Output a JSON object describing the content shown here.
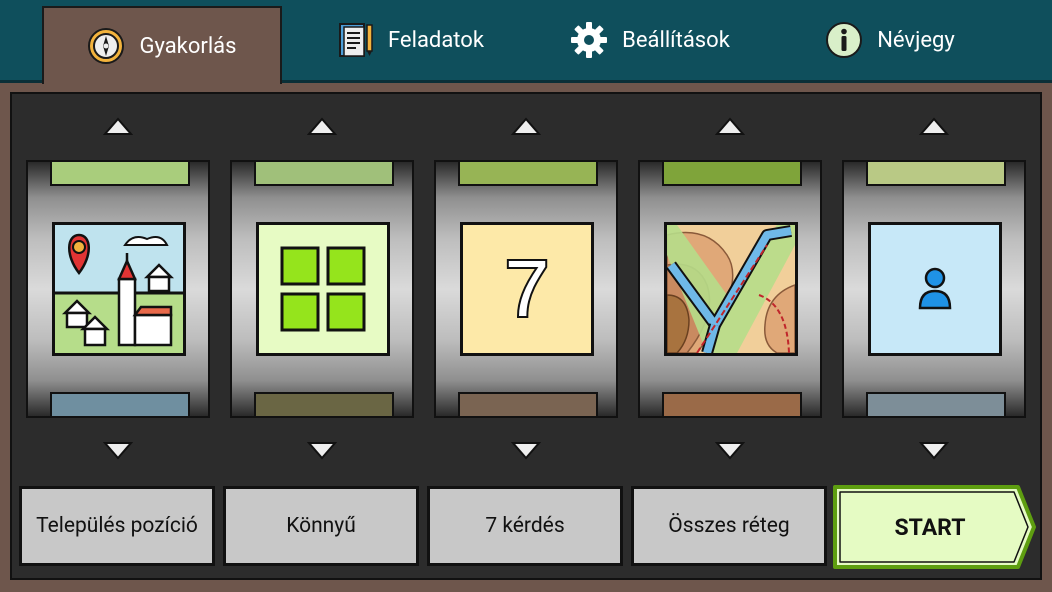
{
  "tabs": [
    {
      "label": "Gyakorlás",
      "icon": "compass-icon",
      "active": true
    },
    {
      "label": "Feladatok",
      "icon": "tasks-icon",
      "active": false
    },
    {
      "label": "Beállítások",
      "icon": "gear-icon",
      "active": false
    },
    {
      "label": "Névjegy",
      "icon": "info-icon",
      "active": false
    }
  ],
  "selectors": [
    {
      "label": "Település pozíció",
      "icon": "village-location-icon"
    },
    {
      "label": "Könnyű",
      "icon": "difficulty-grid-icon"
    },
    {
      "label": "7 kérdés",
      "icon": "question-count-icon",
      "tile_text": "7"
    },
    {
      "label": "Összes réteg",
      "icon": "map-layers-icon"
    }
  ],
  "start": {
    "label": "START"
  },
  "colors": {
    "tabbar": "#0f4f5c",
    "background": "#6e564c",
    "panel": "#2c2c2c",
    "button": "#c8c8c8",
    "start": "#e5fbc3",
    "start_border": "#5e9e10"
  }
}
